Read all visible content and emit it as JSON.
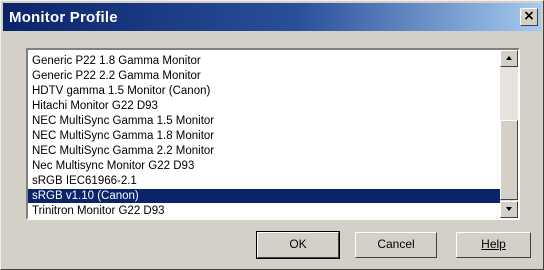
{
  "window": {
    "title": "Monitor Profile",
    "close_glyph": "×"
  },
  "profiles": {
    "items": [
      "Generic P22 1.8 Gamma Monitor",
      "Generic P22 2.2 Gamma Monitor",
      "HDTV gamma 1.5 Monitor (Canon)",
      "Hitachi Monitor G22 D93",
      "NEC MultiSync Gamma 1.5 Monitor",
      "NEC MultiSync Gamma 1.8 Monitor",
      "NEC MultiSync Gamma 2.2 Monitor",
      "Nec Multisync Monitor G22 D93",
      "sRGB IEC61966-2.1",
      "sRGB v1.10 (Canon)",
      "Trinitron Monitor G22 D93"
    ],
    "selected": "sRGB v1.10 (Canon)"
  },
  "buttons": {
    "ok": "OK",
    "cancel": "Cancel",
    "help": "Help"
  },
  "colors": {
    "title_bar": "#0a246a",
    "selection": "#0a246a",
    "dialog_face": "#d4d0c8"
  },
  "icons": {
    "close": "close-icon",
    "scroll_up": "arrow-up-icon",
    "scroll_down": "arrow-down-icon"
  }
}
